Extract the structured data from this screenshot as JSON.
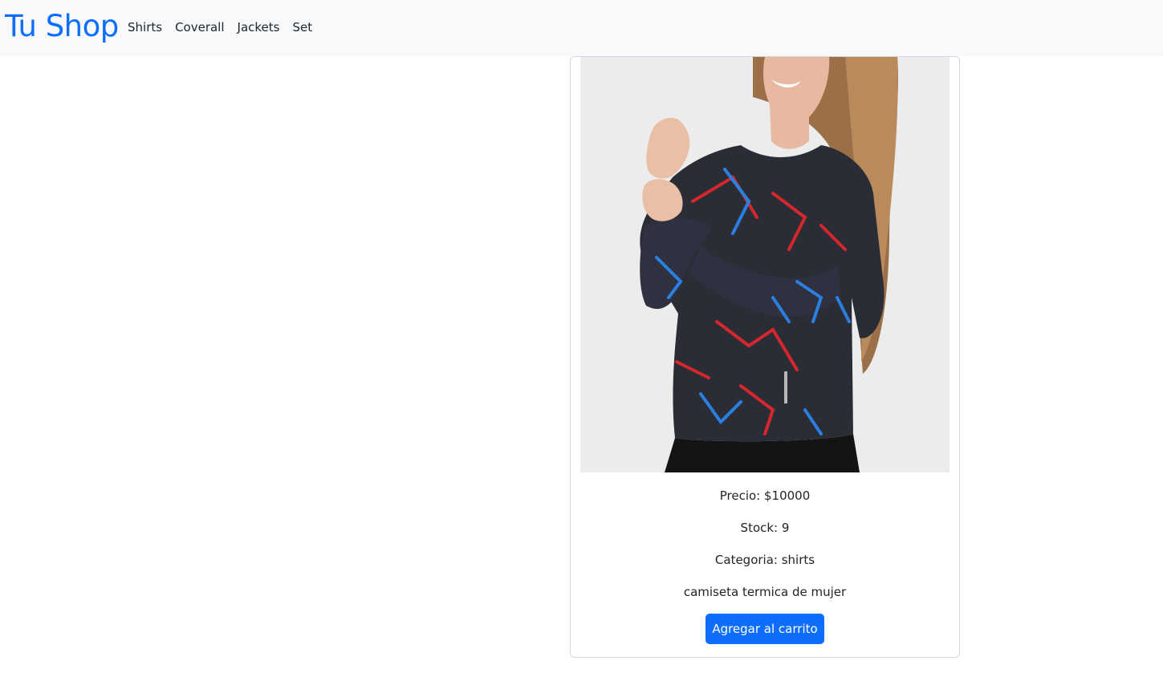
{
  "navbar": {
    "brand": "Tu Shop",
    "links": [
      "Shirts",
      "Coverall",
      "Jackets",
      "Set"
    ]
  },
  "product": {
    "image": "product-photo",
    "precio": "Precio: $10000",
    "stock": "Stock: 9",
    "categoria": "Categoria: shirts",
    "descripcion": "camiseta termica de mujer",
    "button_label": "Agregar al carrito"
  },
  "colors": {
    "brand": "#0d6efd",
    "navbar_bg": "#f8f9fa",
    "button_bg": "#0d6efd",
    "image_bg": "#ececec"
  }
}
